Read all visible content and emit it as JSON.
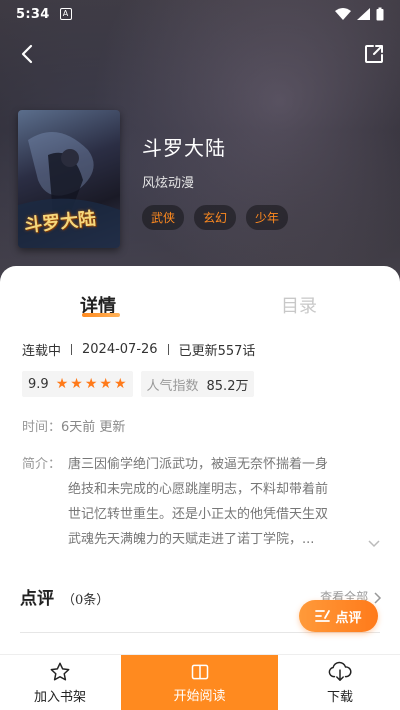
{
  "status_bar": {
    "time": "5:34"
  },
  "book": {
    "cover_text": "斗罗大陆",
    "title": "斗罗大陆",
    "author": "风炫动漫",
    "tags": [
      "武侠",
      "玄幻",
      "少年"
    ]
  },
  "tabs": {
    "detail": "详情",
    "toc": "目录"
  },
  "meta": {
    "status": "连载中",
    "date": "2024-07-26",
    "updated": "已更新557话"
  },
  "score": {
    "rating": "9.9",
    "stars": 5,
    "popularity_label": "人气指数",
    "popularity_value": "85.2万"
  },
  "time_row": {
    "label": "时间：",
    "value": "6天前 更新"
  },
  "intro": {
    "label": "简介：",
    "lines": [
      "唐三因偷学绝门派武功，被逼无奈怀揣着一身",
      "绝技和未完成的心愿跳崖明志，不料却带着前",
      "世记忆转世重生。还是小正太的他凭借天生双",
      "武魂先天满魄力的天赋走进了诺丁学院，..."
    ]
  },
  "review": {
    "title": "点评",
    "count": "（0条）",
    "view_all": "查看全部",
    "fab_label": "点评"
  },
  "bottom_bar": {
    "shelf": "加入书架",
    "read": "开始阅读",
    "download": "下载"
  },
  "colors": {
    "accent": "#ff8a1f",
    "star": "#ff7a1a"
  }
}
